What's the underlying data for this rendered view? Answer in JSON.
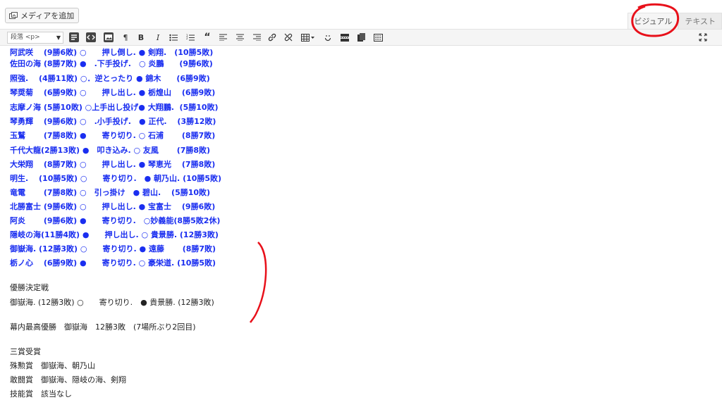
{
  "media_button": {
    "label": "メディアを追加"
  },
  "tabs": {
    "visual": "ビジュアル",
    "text": "テキスト"
  },
  "toolbar": {
    "format_select": "段落 <p>"
  },
  "content": {
    "blue_lines": [
      "阿武咲　 (9勝6敗) ○　　押し倒し. ● 剣翔.　(10勝5敗)",
      "佐田の海 (8勝7敗) ●　.下手投げ.　○ 炎鵬　　(9勝6敗)",
      "照強.　 (4勝11敗) ○．逆とったり ● 錦木　　(6勝9敗)",
      "琴奨菊　 (6勝9敗) ○　　押し出し. ● 栃煌山　 (6勝9敗)",
      "志摩ノ海 (5勝10敗) ○上手出し投げ● 大翔鵬.  (5勝10敗)",
      "琴勇輝　 (9勝6敗) ○　.小手投げ.　● 正代.　 (3勝12敗)",
      "玉鷲　　 (7勝8敗) ●　　寄り切り. ○ 石浦　　 (8勝7敗)",
      "千代大龍(2勝13敗) ●　叩き込み. ○ 友風　　 (7勝8敗)",
      "大栄翔　 (8勝7敗) ○　　押し出し. ● 琴恵光　 (7勝8敗)",
      "明生.　 (10勝5敗) ○　　寄り切り.　● 朝乃山. (10勝5敗)",
      "竜電　　 (7勝8敗) ○　引っ掛け　● 碧山.　 (5勝10敗)",
      "北勝富士 (9勝6敗) ○　　押し出し. ● 宝富士　 (9勝6敗)",
      "阿炎　　 (9勝6敗) ●　　寄り切り.　○妙義能(8勝5敗2休)",
      "隠岐の海(11勝4敗) ●　　押し出し. ○ 貴景勝. (12勝3敗)",
      "御嶽海. (12勝3敗) ○　　寄り切り. ● 遠藤　　 (8勝7敗)",
      "栃ノ心　 (6勝9敗) ●　　寄り切り. ○ 豪栄道. (10勝5敗)"
    ],
    "playoff_heading": "優勝決定戦",
    "playoff_line": "御嶽海. (12勝3敗) ○　　寄り切り.　● 貴景勝. (12勝3敗)",
    "champion_line": "幕内最高優勝　御嶽海　12勝3敗　(7場所ぶり2回目)",
    "awards_heading": "三賞受賞",
    "awards": [
      "殊勲賞　御嶽海、朝乃山",
      "敢闘賞　御嶽海、隠岐の海、剣翔",
      "技能賞　該当なし"
    ]
  },
  "colors": {
    "accent_text": "#1a2ef0",
    "annotation": "#e8101a"
  }
}
